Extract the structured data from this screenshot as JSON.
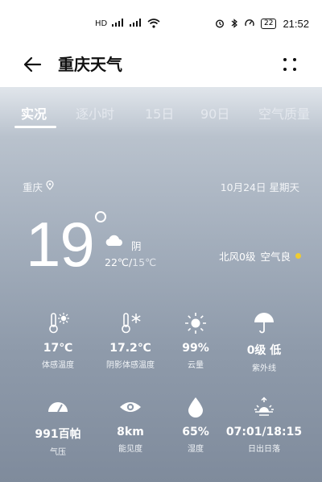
{
  "status_bar": {
    "left_icons": [
      "HD",
      "4G",
      "4G",
      "wifi"
    ],
    "battery": "22",
    "time": "21:52"
  },
  "app_bar": {
    "title": "重庆天气"
  },
  "tabs": [
    {
      "label": "实况",
      "active": true
    },
    {
      "label": "逐小时",
      "active": false
    },
    {
      "label": "15日",
      "active": false
    },
    {
      "label": "90日",
      "active": false
    },
    {
      "label": "空气质量",
      "active": false
    }
  ],
  "location": {
    "city": "重庆",
    "date": "10月24日 星期天"
  },
  "current": {
    "temperature": "19",
    "condition": "阴",
    "high": "22℃",
    "low": "15℃",
    "wind": "北风0级",
    "air": "空气良",
    "air_dot_color": "#f0cc30"
  },
  "details": [
    {
      "icon": "feels-like-temp-icon",
      "value": "17℃",
      "label": "体感温度"
    },
    {
      "icon": "shade-temp-icon",
      "value": "17.2℃",
      "label": "阴影体感温度"
    },
    {
      "icon": "sun-icon",
      "value": "99%",
      "label": "云量"
    },
    {
      "icon": "umbrella-icon",
      "value": "0级 低",
      "label": "紫外线"
    },
    {
      "icon": "gauge-icon",
      "value": "991百帕",
      "label": "气压"
    },
    {
      "icon": "eye-icon",
      "value": "8km",
      "label": "能见度"
    },
    {
      "icon": "water-drop-icon",
      "value": "65%",
      "label": "湿度"
    },
    {
      "icon": "sunrise-sunset-icon",
      "value": "07:01/18:15",
      "label": "日出日落"
    }
  ]
}
